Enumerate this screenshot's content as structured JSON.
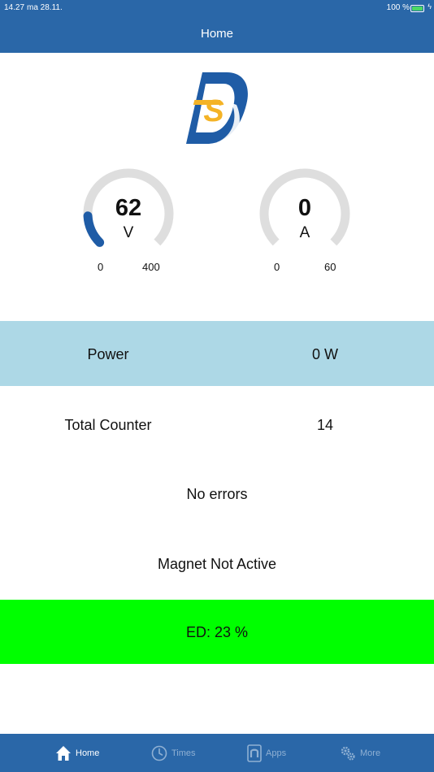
{
  "status_bar": {
    "time": "14.27",
    "date": "ma 28.11.",
    "battery": "100 %",
    "battery_level": 1.0
  },
  "nav": {
    "title": "Home"
  },
  "colors": {
    "bar": "#2a67a8",
    "gauge_track": "#dedede",
    "gauge_fill": "#1f5ca6",
    "power_row": "#add8e6",
    "ed_row": "#00ff00",
    "tab_active": "#ffffff",
    "tab_inactive": "#8fb0d3"
  },
  "gauges": [
    {
      "value": "62",
      "unit": "V",
      "min": "0",
      "max": "400",
      "fraction": 0.155
    },
    {
      "value": "0",
      "unit": "A",
      "min": "0",
      "max": "60",
      "fraction": 0
    }
  ],
  "power": {
    "label": "Power",
    "value": "0 W"
  },
  "counter": {
    "label": "Total Counter",
    "value": "14"
  },
  "errors": "No errors",
  "magnet": "Magnet Not Active",
  "ed": "ED: 23 %",
  "tabs": [
    {
      "label": "Home",
      "icon": "home-icon",
      "active": true
    },
    {
      "label": "Times",
      "icon": "clock-icon",
      "active": false
    },
    {
      "label": "Apps",
      "icon": "magnet-icon",
      "active": false
    },
    {
      "label": "More",
      "icon": "gears-icon",
      "active": false
    }
  ]
}
